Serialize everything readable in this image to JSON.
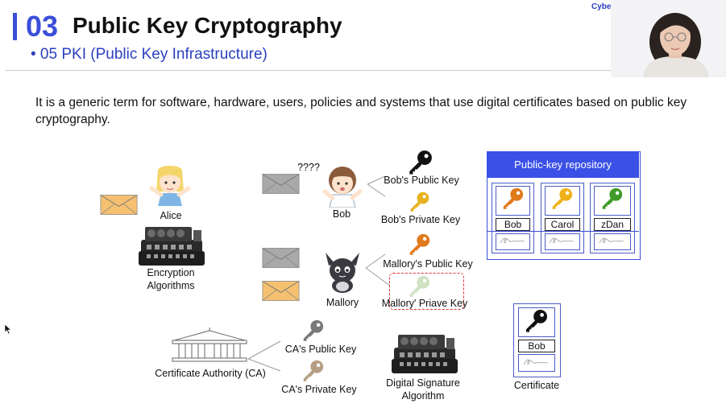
{
  "header": {
    "brand": "Cybe",
    "section_number": "03",
    "section_title": "Public Key Cryptography",
    "subtitle": "• 05 PKI (Public Key Infrastructure)"
  },
  "description": "It is a generic term for software, hardware, users, policies and systems that use digital certificates based on public key cryptography.",
  "diagram": {
    "alice": "Alice",
    "encryption": [
      "Encryption",
      "Algorithms"
    ],
    "bob": "Bob",
    "question": "????",
    "bob_public_key": "Bob's Public Key",
    "bob_private_key": "Bob's Private Key",
    "mallory": "Mallory",
    "mallory_public_key": "Mallory's Public Key",
    "mallory_private_key": "Mallory' Priave Key",
    "ca": "Certificate Authority (CA)",
    "ca_public_key": "CA's Public Key",
    "ca_private_key": "CA's Private Key",
    "signature": [
      "Digital Signature",
      "Algorithm"
    ],
    "repository": {
      "title": "Public-key repository",
      "entries": [
        {
          "name": "Bob",
          "key_color": "#e07a1a"
        },
        {
          "name": "Carol",
          "key_color": "#f0b21c"
        },
        {
          "name": "zDan",
          "key_color": "#3f9a2a"
        }
      ]
    },
    "certificate": {
      "name": "Bob",
      "label": "Certificate"
    }
  },
  "colors": {
    "accent": "#3b4fd8",
    "repo_header": "#3b50e6",
    "envelope_orange": "#f5c070",
    "envelope_gray": "#a9a9a9",
    "key_black": "#111111",
    "key_gold": "#e6b21f",
    "key_orange": "#e07a1a",
    "key_pale": "#cfe3c4",
    "key_gray": "#7a7a7a",
    "key_tan": "#b59f84",
    "dashed_box": "#e03030"
  }
}
